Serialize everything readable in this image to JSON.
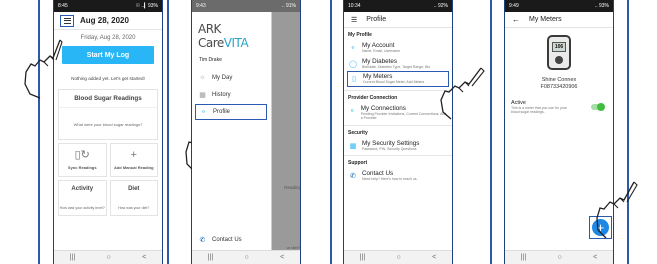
{
  "panel1": {
    "status": {
      "time": "8:45",
      "signal": "☉ ..▎93%"
    },
    "date_header": "Aug 28, 2020",
    "date_sub": "Friday, Aug 28, 2020",
    "start_label": "Start My Log",
    "nothing_text": "Nothing added yet. Let's get started!",
    "bs_title": "Blood Sugar Readings",
    "bs_question": "What were your blood sugar readings?",
    "sync_label": "Sync Readings",
    "manual_label": "Add Manual Reading",
    "activity_title": "Activity",
    "activity_question": "How was your activity level?",
    "diet_title": "Diet",
    "diet_question": "How was your diet?"
  },
  "panel2": {
    "status": {
      "time": "9:43",
      "signal": ".. 91%"
    },
    "logo_a": "ARK Care",
    "logo_b": "VITA",
    "user": "Tim Drake",
    "items": [
      {
        "label": "My Day",
        "icon": "sun-icon"
      },
      {
        "label": "History",
        "icon": "calendar-icon"
      },
      {
        "label": "Profile",
        "icon": "person-icon"
      }
    ],
    "shade_reading": "Reading",
    "shade_diet": "ur diet?",
    "contact": "Contact Us"
  },
  "panel3": {
    "status": {
      "time": "10:34",
      "signal": ".. 92%"
    },
    "title": "Profile",
    "sec_profile": "My Profile",
    "account_title": "My Account",
    "account_sub": "Name, Email, Username",
    "diabetes_title": "My Diabetes",
    "diabetes_sub": "Birthdate, Diabetes Type, Target Range, Bio",
    "meters_title": "My Meters",
    "meters_sub": "Current Blood Sugar Meter, Add Meters",
    "sec_provider": "Provider Connection",
    "connections_title": "My Connections",
    "connections_sub": "Pending Provider Invitations, Current Connections, Add a Provider",
    "sec_security": "Security",
    "security_title": "My Security Settings",
    "security_sub": "Password, PIN, Security Questions",
    "sec_support": "Support",
    "contact_title": "Contact Us",
    "contact_sub": "Need help? Here's how to reach us."
  },
  "panel4": {
    "status": {
      "time": "9:49",
      "signal": ".. 93%"
    },
    "title": "My Meters",
    "meter_screen": "106",
    "meter_name": "Shine Connex",
    "meter_serial": "F08733420906",
    "active_label": "Active",
    "active_sub": "This is a meter that you use for your blood sugar readings.",
    "active_on": true,
    "fab_symbol": "+"
  },
  "nav": {
    "recent": "|||",
    "home": "○",
    "back": "<"
  },
  "colors": {
    "accent": "#29b6f6",
    "highlight": "#2a5bb0",
    "fab": "#1e88e5",
    "toggle": "#3ebd3e"
  }
}
